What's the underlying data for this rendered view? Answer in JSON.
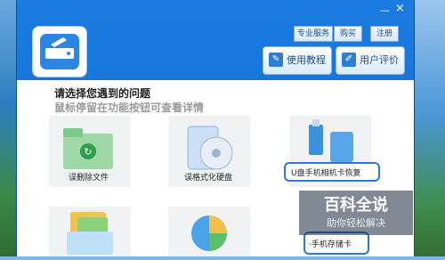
{
  "window": {
    "minimize_glyph": "—",
    "close_glyph": "×"
  },
  "toolbar": {
    "service": "专业服务",
    "buy": "购买",
    "register": "注册"
  },
  "actions": {
    "tutorial": "使用教程",
    "review": "用户评价"
  },
  "main": {
    "title": "请选择您遇到的问题",
    "hint": "鼠标停留在功能按钮可查看详情",
    "options": [
      {
        "label": "误删除文件"
      },
      {
        "label": "误格式化硬盘"
      },
      {
        "label": "U盘手机相机卡恢复"
      }
    ],
    "popup_item": "·手机存储卡"
  },
  "watermark": {
    "brand": "百科全说",
    "slogan": "助你轻松解决"
  },
  "colors": {
    "window_blue": "#1a7be0",
    "accent": "#2b78d8"
  }
}
